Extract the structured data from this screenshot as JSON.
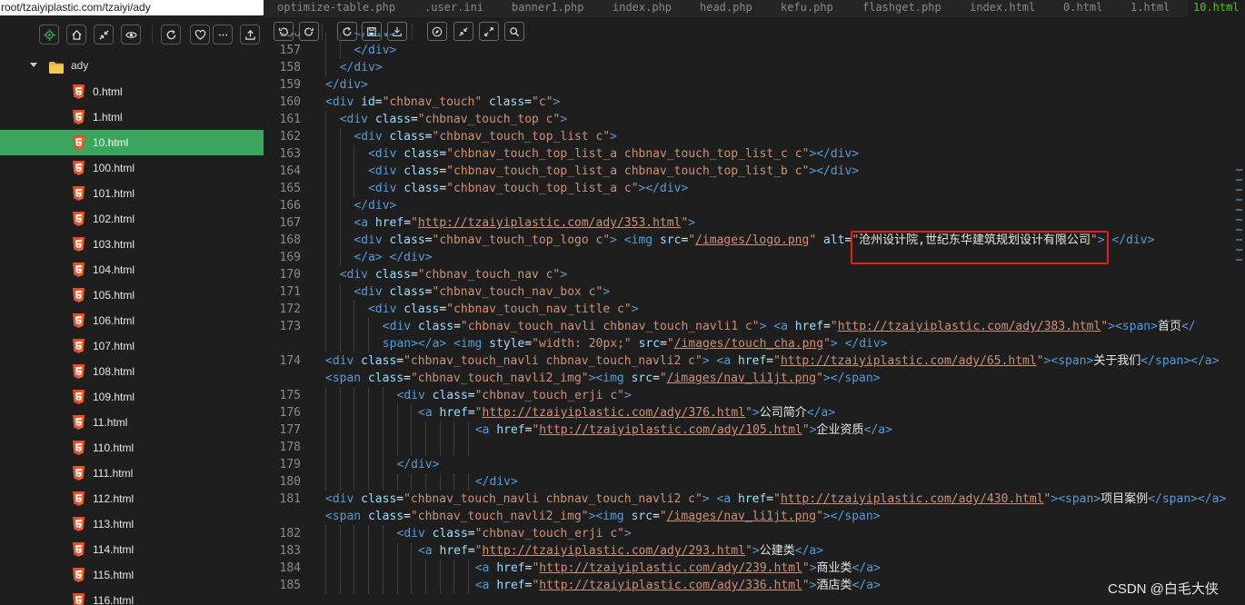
{
  "sidebar": {
    "path": "root/tzaiyiplastic.com/tzaiyi/ady",
    "toolbar_icons": [
      "locate-icon",
      "home-icon",
      "collapse-icon",
      "eye-icon",
      "refresh-icon",
      "favorite-icon",
      "more-icon",
      "upload-icon"
    ],
    "folder": "ady",
    "files": [
      "0.html",
      "1.html",
      "10.html",
      "100.html",
      "101.html",
      "102.html",
      "103.html",
      "104.html",
      "105.html",
      "106.html",
      "107.html",
      "108.html",
      "109.html",
      "11.html",
      "110.html",
      "111.html",
      "112.html",
      "113.html",
      "114.html",
      "115.html",
      "116.html"
    ],
    "active_file": "10.html"
  },
  "tabs": [
    "optimize-table.php",
    ".user.ini",
    "banner1.php",
    "index.php",
    "head.php",
    "kefu.php",
    "flashget.php",
    "index.html",
    "0.html",
    "1.html",
    "10.html"
  ],
  "active_tab": "10.html",
  "editor_toolbar": [
    "undo-icon",
    "redo-icon",
    "reload-icon",
    "save-icon",
    "download-icon",
    "compass-icon",
    "shrink-icon",
    "expand-icon",
    "search-icon"
  ],
  "code": {
    "lines": [
      {
        "n": "156",
        "indent": 4,
        "tokens": [
          [
            "t",
            "</div>"
          ]
        ]
      },
      {
        "n": "157",
        "indent": 4,
        "tokens": [
          [
            "t",
            "</div>"
          ]
        ]
      },
      {
        "n": "158",
        "indent": 2,
        "tokens": [
          [
            "t",
            "</div>"
          ]
        ]
      },
      {
        "n": "159",
        "indent": 0,
        "tokens": [
          [
            "t",
            "</div>"
          ]
        ]
      },
      {
        "n": "160",
        "indent": 0,
        "tokens": [
          [
            "t",
            "<div "
          ],
          [
            "a",
            "id"
          ],
          [
            "x",
            "="
          ],
          [
            "v",
            "\"chbnav_touch\""
          ],
          [
            "x",
            " "
          ],
          [
            "a",
            "class"
          ],
          [
            "x",
            "="
          ],
          [
            "v",
            "\"c\""
          ],
          [
            "t",
            ">"
          ]
        ]
      },
      {
        "n": "161",
        "indent": 2,
        "tokens": [
          [
            "t",
            "<div "
          ],
          [
            "a",
            "class"
          ],
          [
            "x",
            "="
          ],
          [
            "v",
            "\"chbnav_touch_top c\""
          ],
          [
            "t",
            ">"
          ]
        ]
      },
      {
        "n": "162",
        "indent": 4,
        "tokens": [
          [
            "t",
            "<div "
          ],
          [
            "a",
            "class"
          ],
          [
            "x",
            "="
          ],
          [
            "v",
            "\"chbnav_touch_top_list c\""
          ],
          [
            "t",
            ">"
          ]
        ]
      },
      {
        "n": "163",
        "indent": 6,
        "tokens": [
          [
            "t",
            "<div "
          ],
          [
            "a",
            "class"
          ],
          [
            "x",
            "="
          ],
          [
            "v",
            "\"chbnav_touch_top_list_a chbnav_touch_top_list_c c\""
          ],
          [
            "t",
            "></div>"
          ]
        ]
      },
      {
        "n": "164",
        "indent": 6,
        "tokens": [
          [
            "t",
            "<div "
          ],
          [
            "a",
            "class"
          ],
          [
            "x",
            "="
          ],
          [
            "v",
            "\"chbnav_touch_top_list_a chbnav_touch_top_list_b c\""
          ],
          [
            "t",
            "></div>"
          ]
        ]
      },
      {
        "n": "165",
        "indent": 6,
        "tokens": [
          [
            "t",
            "<div "
          ],
          [
            "a",
            "class"
          ],
          [
            "x",
            "="
          ],
          [
            "v",
            "\"chbnav_touch_top_list_a c\""
          ],
          [
            "t",
            "></div>"
          ]
        ]
      },
      {
        "n": "166",
        "indent": 4,
        "tokens": [
          [
            "t",
            "</div>"
          ]
        ]
      },
      {
        "n": "167",
        "indent": 4,
        "tokens": [
          [
            "t",
            "<a "
          ],
          [
            "a",
            "href"
          ],
          [
            "x",
            "="
          ],
          [
            "v",
            "\""
          ],
          [
            "u",
            "http://tzaiyiplastic.com/ady/353.html"
          ],
          [
            "v",
            "\""
          ],
          [
            "t",
            ">"
          ]
        ]
      },
      {
        "n": "168",
        "indent": 4,
        "tokens": [
          [
            "t",
            "<div "
          ],
          [
            "a",
            "class"
          ],
          [
            "x",
            "="
          ],
          [
            "v",
            "\"chbnav_touch_top_logo c\""
          ],
          [
            "t",
            "> <img "
          ],
          [
            "a",
            "src"
          ],
          [
            "x",
            "="
          ],
          [
            "v",
            "\""
          ],
          [
            "u",
            "/images/logo.png"
          ],
          [
            "v",
            "\""
          ],
          [
            "x",
            " "
          ],
          [
            "a",
            "alt"
          ],
          [
            "x",
            "="
          ],
          [
            "v",
            "\""
          ],
          [
            "x",
            "沧州设计院,世纪东华建筑规划设计有限公司"
          ],
          [
            "v",
            "\""
          ],
          [
            "t",
            "> </div>"
          ]
        ]
      },
      {
        "n": "169",
        "indent": 4,
        "tokens": [
          [
            "t",
            "</a> </div>"
          ]
        ]
      },
      {
        "n": "170",
        "indent": 2,
        "tokens": [
          [
            "t",
            "<div "
          ],
          [
            "a",
            "class"
          ],
          [
            "x",
            "="
          ],
          [
            "v",
            "\"chbnav_touch_nav c\""
          ],
          [
            "t",
            ">"
          ]
        ]
      },
      {
        "n": "171",
        "indent": 4,
        "tokens": [
          [
            "t",
            "<div "
          ],
          [
            "a",
            "class"
          ],
          [
            "x",
            "="
          ],
          [
            "v",
            "\"chbnav_touch_nav_box c\""
          ],
          [
            "t",
            ">"
          ]
        ]
      },
      {
        "n": "172",
        "indent": 6,
        "tokens": [
          [
            "t",
            "<div "
          ],
          [
            "a",
            "class"
          ],
          [
            "x",
            "="
          ],
          [
            "v",
            "\"chbnav_touch_nav_title c\""
          ],
          [
            "t",
            ">"
          ]
        ]
      },
      {
        "n": "173",
        "indent": 8,
        "tokens": [
          [
            "t",
            "<div "
          ],
          [
            "a",
            "class"
          ],
          [
            "x",
            "="
          ],
          [
            "v",
            "\"chbnav_touch_navli chbnav_touch_navli1 c\""
          ],
          [
            "t",
            "> <a "
          ],
          [
            "a",
            "href"
          ],
          [
            "x",
            "="
          ],
          [
            "v",
            "\""
          ],
          [
            "u",
            "http://tzaiyiplastic.com/ady/383.html"
          ],
          [
            "v",
            "\""
          ],
          [
            "t",
            "><span>"
          ],
          [
            "x",
            "首页"
          ],
          [
            "t",
            "</"
          ]
        ]
      },
      {
        "n": "",
        "indent": 8,
        "tokens": [
          [
            "t",
            "span></a> <img "
          ],
          [
            "a",
            "style"
          ],
          [
            "x",
            "="
          ],
          [
            "v",
            "\"width: 20px;\""
          ],
          [
            "x",
            " "
          ],
          [
            "a",
            "src"
          ],
          [
            "x",
            "="
          ],
          [
            "v",
            "\""
          ],
          [
            "u",
            "/images/touch_cha.png"
          ],
          [
            "v",
            "\""
          ],
          [
            "t",
            "> </div>"
          ]
        ]
      },
      {
        "n": "174",
        "indent": 0,
        "tokens": [
          [
            "t",
            "<div "
          ],
          [
            "a",
            "class"
          ],
          [
            "x",
            "="
          ],
          [
            "v",
            "\"chbnav_touch_navli chbnav_touch_navli2 c\""
          ],
          [
            "t",
            "> <a "
          ],
          [
            "a",
            "href"
          ],
          [
            "x",
            "="
          ],
          [
            "v",
            "\""
          ],
          [
            "u",
            "http://tzaiyiplastic.com/ady/65.html"
          ],
          [
            "v",
            "\""
          ],
          [
            "t",
            "><span>"
          ],
          [
            "x",
            "关于我们"
          ],
          [
            "t",
            "</span></a>"
          ]
        ]
      },
      {
        "n": "",
        "indent": 0,
        "tokens": [
          [
            "t",
            "<span "
          ],
          [
            "a",
            "class"
          ],
          [
            "x",
            "="
          ],
          [
            "v",
            "\"chbnav_touch_navli2_img\""
          ],
          [
            "t",
            "><img "
          ],
          [
            "a",
            "src"
          ],
          [
            "x",
            "="
          ],
          [
            "v",
            "\""
          ],
          [
            "u",
            "/images/nav_li1jt.png"
          ],
          [
            "v",
            "\""
          ],
          [
            "t",
            "></span>"
          ]
        ]
      },
      {
        "n": "175",
        "indent": 10,
        "tokens": [
          [
            "t",
            "<div "
          ],
          [
            "a",
            "class"
          ],
          [
            "x",
            "="
          ],
          [
            "v",
            "\"chbnav_touch_erji c\""
          ],
          [
            "t",
            ">"
          ]
        ]
      },
      {
        "n": "176",
        "indent": 13,
        "tokens": [
          [
            "t",
            "<a "
          ],
          [
            "a",
            "href"
          ],
          [
            "x",
            "="
          ],
          [
            "v",
            "\""
          ],
          [
            "u",
            "http://tzaiyiplastic.com/ady/376.html"
          ],
          [
            "v",
            "\""
          ],
          [
            "t",
            ">"
          ],
          [
            "x",
            "公司简介"
          ],
          [
            "t",
            "</a>"
          ]
        ]
      },
      {
        "n": "177",
        "indent": 21,
        "tokens": [
          [
            "t",
            "<a "
          ],
          [
            "a",
            "href"
          ],
          [
            "x",
            "="
          ],
          [
            "v",
            "\""
          ],
          [
            "u",
            "http://tzaiyiplastic.com/ady/105.html"
          ],
          [
            "v",
            "\""
          ],
          [
            "t",
            ">"
          ],
          [
            "x",
            "企业资质"
          ],
          [
            "t",
            "</a>"
          ]
        ]
      },
      {
        "n": "178",
        "indent": 21,
        "tokens": []
      },
      {
        "n": "179",
        "indent": 10,
        "tokens": [
          [
            "t",
            "</div>"
          ]
        ]
      },
      {
        "n": "180",
        "indent": 21,
        "tokens": [
          [
            "t",
            "</div>"
          ]
        ]
      },
      {
        "n": "181",
        "indent": 0,
        "tokens": [
          [
            "t",
            "<div "
          ],
          [
            "a",
            "class"
          ],
          [
            "x",
            "="
          ],
          [
            "v",
            "\"chbnav_touch_navli chbnav_touch_navli2 c\""
          ],
          [
            "t",
            "> <a "
          ],
          [
            "a",
            "href"
          ],
          [
            "x",
            "="
          ],
          [
            "v",
            "\""
          ],
          [
            "u",
            "http://tzaiyiplastic.com/ady/430.html"
          ],
          [
            "v",
            "\""
          ],
          [
            "t",
            "><span>"
          ],
          [
            "x",
            "项目案例"
          ],
          [
            "t",
            "</span></a>"
          ]
        ]
      },
      {
        "n": "",
        "indent": 0,
        "tokens": [
          [
            "t",
            "<span "
          ],
          [
            "a",
            "class"
          ],
          [
            "x",
            "="
          ],
          [
            "v",
            "\"chbnav_touch_navli2_img\""
          ],
          [
            "t",
            "><img "
          ],
          [
            "a",
            "src"
          ],
          [
            "x",
            "="
          ],
          [
            "v",
            "\""
          ],
          [
            "u",
            "/images/nav_li1jt.png"
          ],
          [
            "v",
            "\""
          ],
          [
            "t",
            "></span>"
          ]
        ]
      },
      {
        "n": "182",
        "indent": 10,
        "tokens": [
          [
            "t",
            "<div "
          ],
          [
            "a",
            "class"
          ],
          [
            "x",
            "="
          ],
          [
            "v",
            "\"chbnav_touch_erji c\""
          ],
          [
            "t",
            ">"
          ]
        ]
      },
      {
        "n": "183",
        "indent": 13,
        "tokens": [
          [
            "t",
            "<a "
          ],
          [
            "a",
            "href"
          ],
          [
            "x",
            "="
          ],
          [
            "v",
            "\""
          ],
          [
            "u",
            "http://tzaiyiplastic.com/ady/293.html"
          ],
          [
            "v",
            "\""
          ],
          [
            "t",
            ">"
          ],
          [
            "x",
            "公建类"
          ],
          [
            "t",
            "</a>"
          ]
        ]
      },
      {
        "n": "184",
        "indent": 21,
        "tokens": [
          [
            "t",
            "<a "
          ],
          [
            "a",
            "href"
          ],
          [
            "x",
            "="
          ],
          [
            "v",
            "\""
          ],
          [
            "u",
            "http://tzaiyiplastic.com/ady/239.html"
          ],
          [
            "v",
            "\""
          ],
          [
            "t",
            ">"
          ],
          [
            "x",
            "商业类"
          ],
          [
            "t",
            "</a>"
          ]
        ]
      },
      {
        "n": "185",
        "indent": 21,
        "tokens": [
          [
            "t",
            "<a "
          ],
          [
            "a",
            "href"
          ],
          [
            "x",
            "="
          ],
          [
            "v",
            "\""
          ],
          [
            "u",
            "http://tzaiyiplastic.com/ady/336.html"
          ],
          [
            "v",
            "\""
          ],
          [
            "t",
            ">"
          ],
          [
            "x",
            "酒店类"
          ],
          [
            "t",
            "</a>"
          ]
        ]
      }
    ]
  },
  "watermark": "CSDN @白毛大侠"
}
